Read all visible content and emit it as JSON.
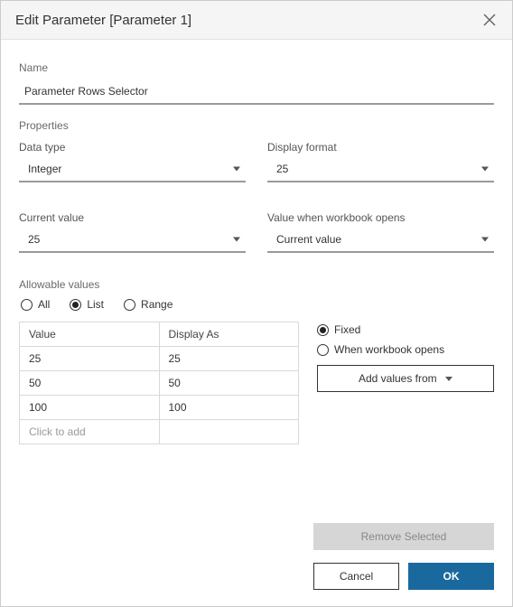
{
  "header": {
    "title": "Edit Parameter [Parameter 1]"
  },
  "name": {
    "label": "Name",
    "value": "Parameter Rows Selector"
  },
  "properties": {
    "section_label": "Properties",
    "data_type": {
      "label": "Data type",
      "value": "Integer"
    },
    "display_format": {
      "label": "Display format",
      "value": "25"
    },
    "current_value": {
      "label": "Current value",
      "value": "25"
    },
    "value_when_open": {
      "label": "Value when workbook opens",
      "value": "Current value"
    }
  },
  "allowable": {
    "section_label": "Allowable values",
    "options": {
      "all": "All",
      "list": "List",
      "range": "Range"
    },
    "selected": "list",
    "table": {
      "col_value": "Value",
      "col_display": "Display As",
      "rows": [
        {
          "value": "25",
          "display": "25"
        },
        {
          "value": "50",
          "display": "50"
        },
        {
          "value": "100",
          "display": "100"
        }
      ],
      "placeholder": "Click to add"
    },
    "load_mode": {
      "fixed": "Fixed",
      "when_open": "When workbook opens",
      "selected": "fixed"
    },
    "add_values_from": "Add values from"
  },
  "footer": {
    "remove_selected": "Remove Selected",
    "cancel": "Cancel",
    "ok": "OK"
  }
}
